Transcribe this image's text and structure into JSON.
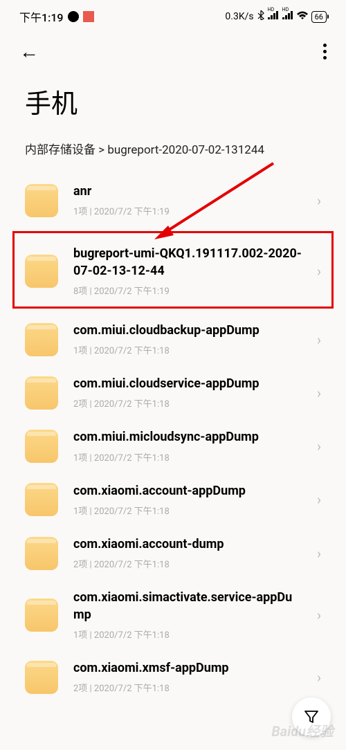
{
  "status": {
    "time": "下午1:19",
    "network_speed": "0.3K/s",
    "hd_label_1": "HD",
    "hd_label_2": "HD",
    "battery": "66"
  },
  "page": {
    "title": "手机"
  },
  "breadcrumb": {
    "text": "内部存储设备 > bugreport-2020-07-02-131244"
  },
  "items": [
    {
      "name": "anr",
      "meta": "1项  |  2020/7/2 下午1:19"
    },
    {
      "name": "bugreport-umi-QKQ1.191117.002-2020-07-02-13-12-44",
      "meta": "8项  |  2020/7/2 下午1:19",
      "highlighted": true
    },
    {
      "name": "com.miui.cloudbackup-appDump",
      "meta": "1项  |  2020/7/2 下午1:18"
    },
    {
      "name": "com.miui.cloudservice-appDump",
      "meta": "2项  |  2020/7/2 下午1:18"
    },
    {
      "name": "com.miui.micloudsync-appDump",
      "meta": "1项  |  2020/7/2 下午1:18"
    },
    {
      "name": "com.xiaomi.account-appDump",
      "meta": "1项  |  2020/7/2 下午1:18"
    },
    {
      "name": "com.xiaomi.account-dump",
      "meta": "2项  |  2020/7/2 下午1:18"
    },
    {
      "name": "com.xiaomi.simactivate.service-appDump",
      "meta": "1项  |  2020/7/2 下午1:18"
    },
    {
      "name": "com.xiaomi.xmsf-appDump",
      "meta": "2项  |  2020/7/2 下午1:18"
    }
  ],
  "watermark": "Baidu经验"
}
